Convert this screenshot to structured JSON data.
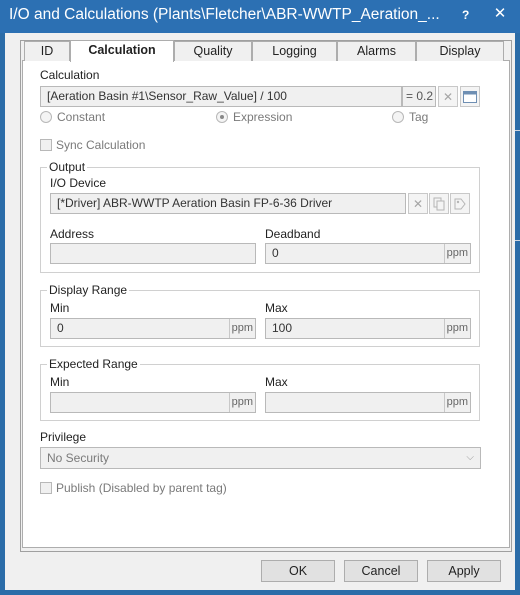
{
  "window": {
    "title": "I/O and Calculations (Plants\\Fletcher\\ABR-WWTP_Aeration_...",
    "help_label": "?",
    "close_label": "✕"
  },
  "tabs": [
    {
      "label": "ID"
    },
    {
      "label": "Calculation",
      "active": true
    },
    {
      "label": "Quality"
    },
    {
      "label": "Logging"
    },
    {
      "label": "Alarms"
    },
    {
      "label": "Display"
    }
  ],
  "calculation": {
    "section_label": "Calculation",
    "expression": "[Aeration Basin #1\\Sensor_Raw_Value]  / 100",
    "result": "= 0.2",
    "radio_options": [
      {
        "label": "Constant",
        "checked": false
      },
      {
        "label": "Expression",
        "checked": true
      },
      {
        "label": "Tag",
        "checked": false
      }
    ],
    "sync_label": "Sync Calculation"
  },
  "output": {
    "group_label": "Output",
    "io_device_label": "I/O Device",
    "io_device_value": "[*Driver]   ABR-WWTP Aeration Basin FP-6-36 Driver",
    "address_label": "Address",
    "address_value": "",
    "deadband_label": "Deadband",
    "deadband_value": "0",
    "deadband_unit": "ppm"
  },
  "display_range": {
    "group_label": "Display Range",
    "min_label": "Min",
    "min_value": "0",
    "max_label": "Max",
    "max_value": "100",
    "unit": "ppm"
  },
  "expected_range": {
    "group_label": "Expected Range",
    "min_label": "Min",
    "min_value": "",
    "max_label": "Max",
    "max_value": "",
    "unit": "ppm"
  },
  "privilege": {
    "label": "Privilege",
    "value": "No Security"
  },
  "publish": {
    "label": "Publish (Disabled by parent tag)"
  },
  "buttons": {
    "ok": "OK",
    "cancel": "Cancel",
    "apply": "Apply"
  }
}
